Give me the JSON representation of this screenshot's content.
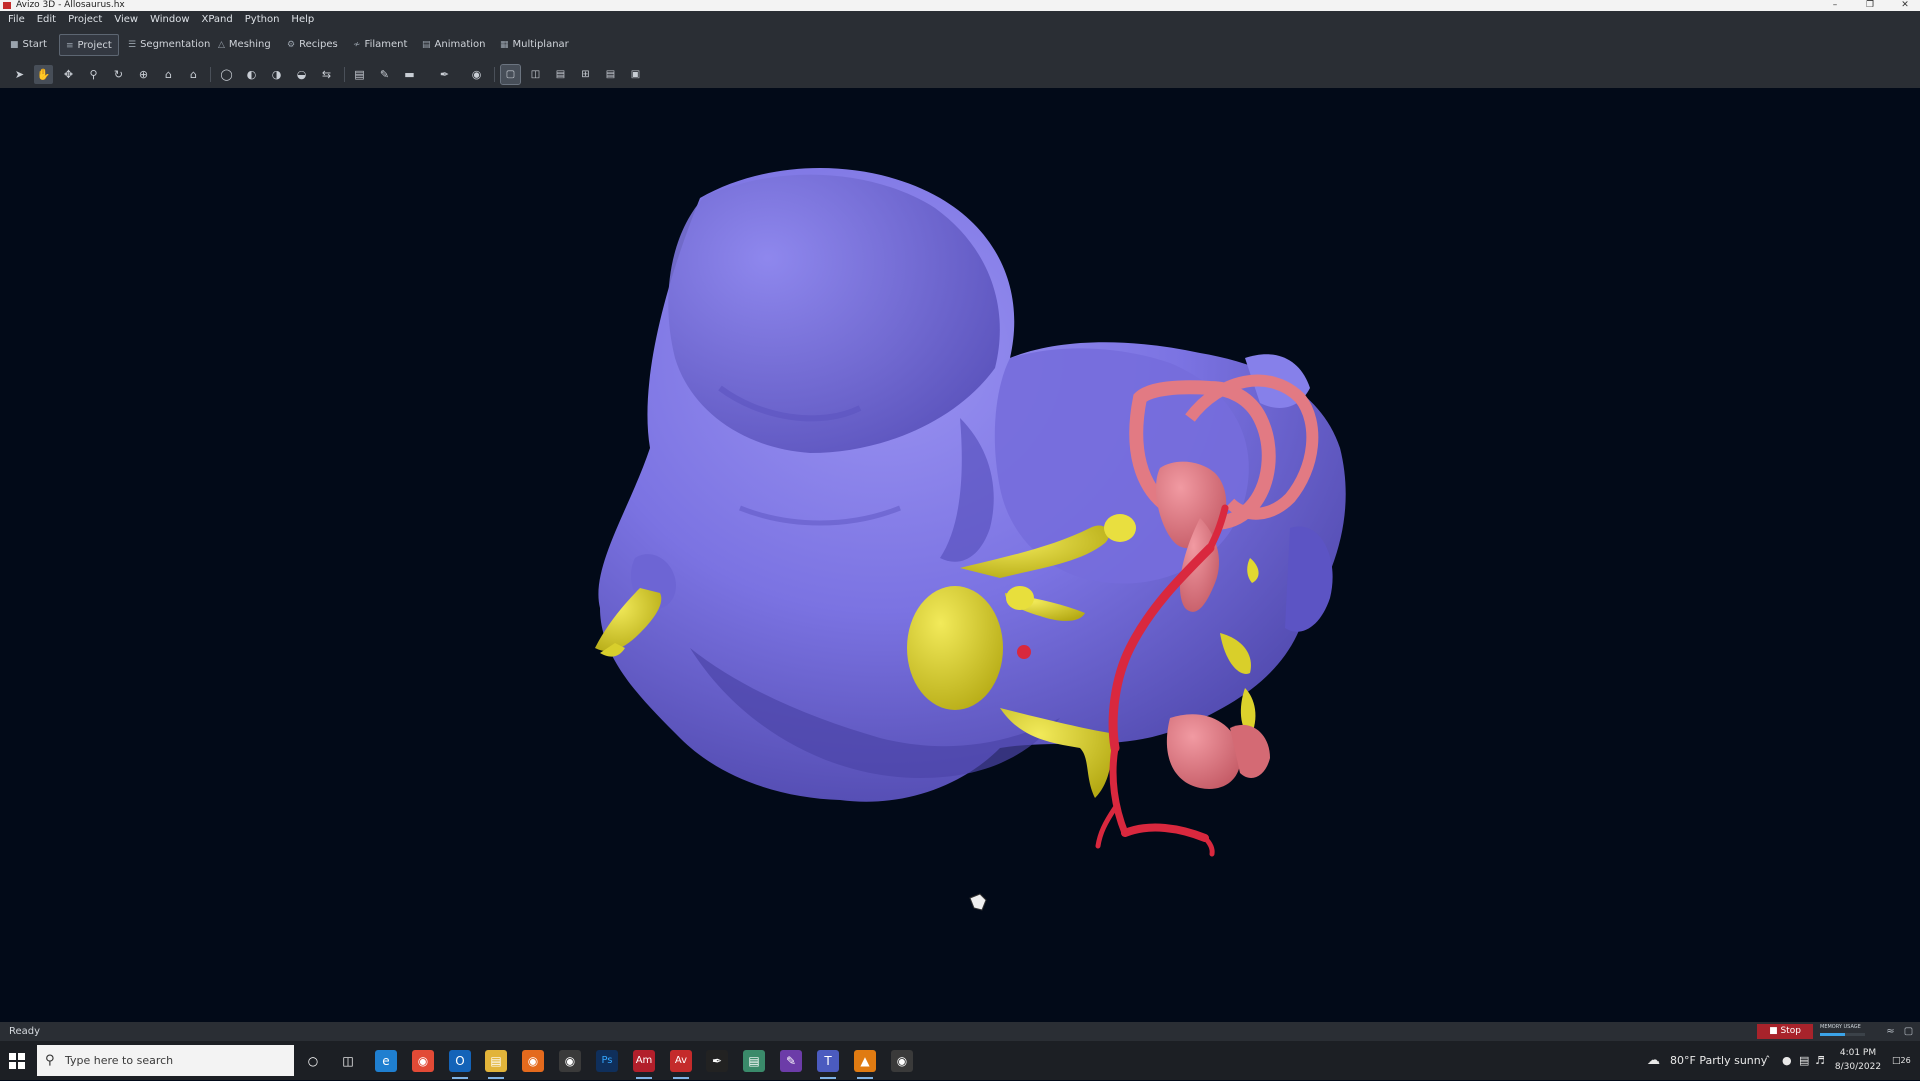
{
  "window": {
    "title": "Avizo 3D - Allosaurus.hx",
    "minimize_symbol": "–",
    "restore_symbol": "❐",
    "close_symbol": "✕"
  },
  "menu": [
    "File",
    "Edit",
    "Project",
    "View",
    "Window",
    "XPand",
    "Python",
    "Help"
  ],
  "workrooms": [
    "Start",
    "Project",
    "Segmentation",
    "Meshing",
    "Recipes",
    "Filament",
    "Animation",
    "Multiplanar"
  ],
  "workroom_active": "Project",
  "toolbar": {
    "tools": [
      "pointer-icon",
      "hand-icon",
      "pan-icon",
      "zoom-icon",
      "rotate-icon",
      "seek-icon",
      "home-icon",
      "set-home-icon",
      "perspective-icon",
      "view-x-icon",
      "view-y-icon",
      "view-z-icon",
      "rotate-axis-icon",
      "measure-icon",
      "probe-icon",
      "ruler-icon",
      "pen-icon",
      "snapshot-icon"
    ],
    "layouts": [
      "layout-single-icon",
      "layout-two-vertical-icon",
      "layout-two-horizontal-icon",
      "layout-four-icon",
      "layout-rows-icon",
      "layout-custom-icon"
    ],
    "active_tool": "hand-icon",
    "active_layout": "layout-single-icon"
  },
  "viewer": {
    "surfaces": [
      "endocast",
      "nerves",
      "inner-ear",
      "vessels"
    ],
    "colors": {
      "endocast": "#7b73e2",
      "nerves": "#e2d62a",
      "inner_ear": "#e27a83",
      "vessels": "#d9283e",
      "background": "#020a18"
    }
  },
  "status": {
    "text": "Ready",
    "stop_label": "Stop",
    "memory_label": "MEMORY USAGE",
    "memory_fraction": 0.55
  },
  "taskbar": {
    "search_placeholder": "Type here to search",
    "apps": [
      "cortana-icon",
      "task-view-icon",
      "edge-icon",
      "chrome-icon",
      "outlook-icon",
      "file-explorer-icon",
      "firefox-icon",
      "obs-icon",
      "photoshop-icon",
      "amira-icon",
      "avizo-icon",
      "inkscape-icon",
      "notepad-icon",
      "onenote-icon",
      "teams-icon",
      "vlc-icon",
      "blender-icon"
    ],
    "photoshop_label": "Ps",
    "amira_label": "Am",
    "avizo_label": "Av",
    "weather": "80°F  Partly sunny",
    "time": "4:01 PM",
    "date": "8/30/2022",
    "notification_count": "26"
  }
}
